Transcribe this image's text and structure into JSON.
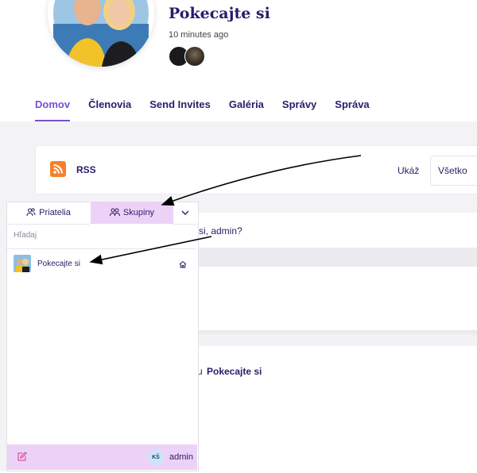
{
  "group": {
    "title": "Pokecajte si",
    "time": "10 minutes ago"
  },
  "nav": [
    "Domov",
    "Členovia",
    "Send Invites",
    "Galéria",
    "Správy",
    "Správa"
  ],
  "activity": {
    "rss_label": "RSS",
    "show_label": "Ukáž",
    "filter_value": "Všetko",
    "question_fragment": "si, admin?",
    "activity_prefix": "u",
    "activity_group": "Pokecajte si"
  },
  "popup": {
    "tab_friends": "Priatelia",
    "tab_groups": "Skupiny",
    "search_placeholder": "Hľadaj",
    "group_item": "Pokecajte si",
    "footer_initials": "KŠ",
    "footer_user": "admin"
  },
  "colors": {
    "accent": "#7a4fd0",
    "popup_highlight": "#ecd2f7",
    "rss_orange": "#f4812a"
  },
  "icons": [
    "friends-icon",
    "groups-icon",
    "chevron-down-icon",
    "home-icon",
    "edit-icon",
    "rss-icon"
  ]
}
